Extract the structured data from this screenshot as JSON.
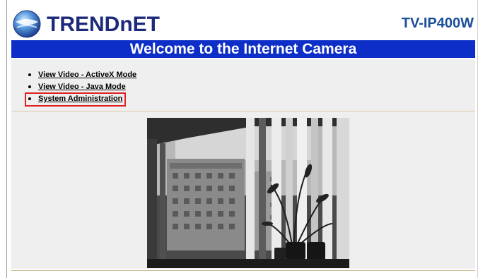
{
  "header": {
    "brand": "TRENDnET",
    "model": "TV-IP400W"
  },
  "title_bar": {
    "text": "Welcome to the Internet Camera"
  },
  "menu": {
    "items": [
      {
        "label": "View Video - ActiveX Mode"
      },
      {
        "label": "View Video - Java Mode"
      },
      {
        "label": "System Administration"
      }
    ],
    "highlighted_index": 2
  },
  "colors": {
    "title_bar": "#0e2ec8",
    "brand_text": "#1d2a7a",
    "model_text": "#1b4f98",
    "content_bg": "#efefef",
    "highlight_border": "#e02020"
  },
  "icons": {
    "logo": "globe-icon"
  }
}
